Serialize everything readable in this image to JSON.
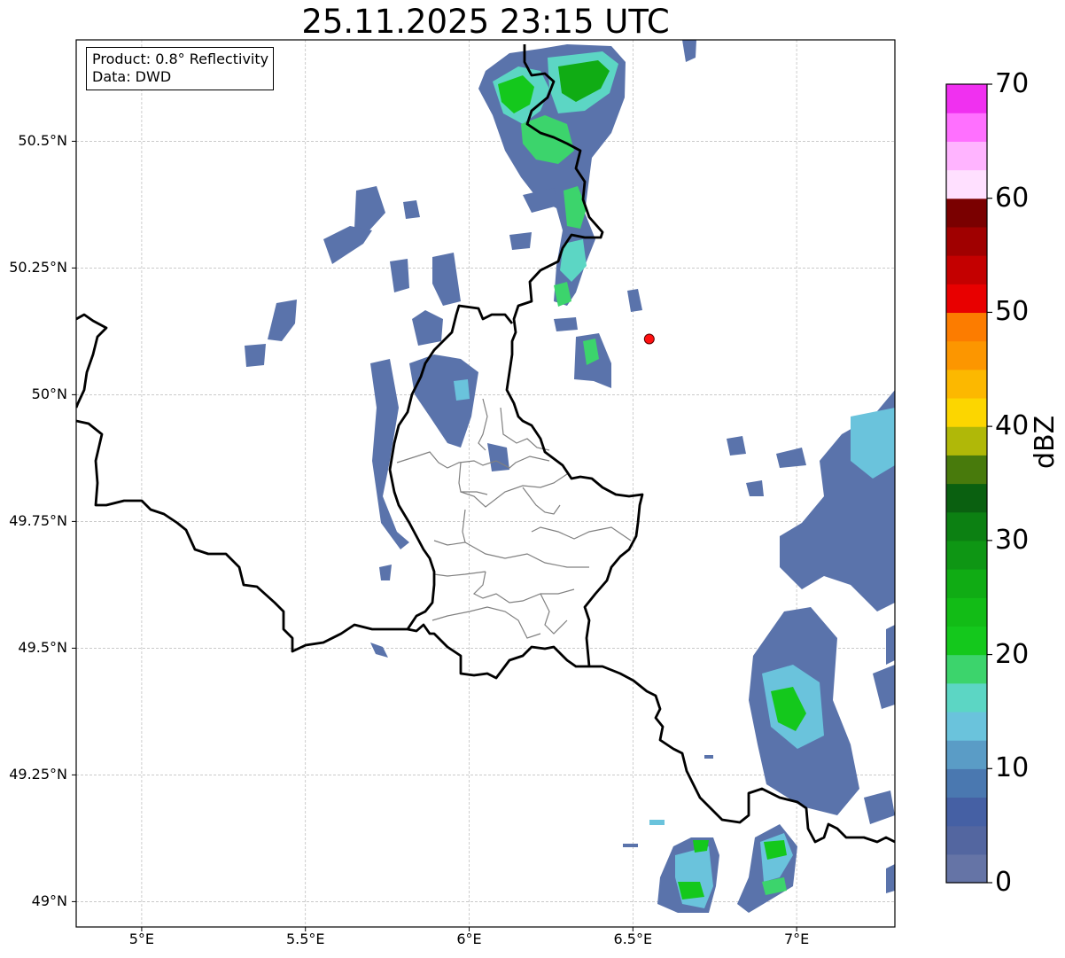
{
  "title": "25.11.2025 23:15 UTC",
  "info": {
    "product": "Product: 0.8° Reflectivity",
    "source": "Data: DWD"
  },
  "map": {
    "extent": {
      "lon_min": 4.8,
      "lon_max": 7.3,
      "lat_min": 48.95,
      "lat_max": 50.7
    },
    "lat_ticks": [
      {
        "value": 50.5,
        "label": "50.5°N"
      },
      {
        "value": 50.25,
        "label": "50.25°N"
      },
      {
        "value": 50.0,
        "label": "50°N"
      },
      {
        "value": 49.75,
        "label": "49.75°N"
      },
      {
        "value": 49.5,
        "label": "49.5°N"
      },
      {
        "value": 49.25,
        "label": "49.25°N"
      },
      {
        "value": 49.0,
        "label": "49°N"
      }
    ],
    "lon_ticks": [
      {
        "value": 5.0,
        "label": "5°E"
      },
      {
        "value": 5.5,
        "label": "5.5°E"
      },
      {
        "value": 6.0,
        "label": "6°E"
      },
      {
        "value": 6.5,
        "label": "6.5°E"
      },
      {
        "value": 7.0,
        "label": "7°E"
      }
    ],
    "gridlines": true,
    "marker": {
      "lon": 6.55,
      "lat": 50.11,
      "color": "#ff1010"
    },
    "border_color": "#000000",
    "district_color": "#808080"
  },
  "colorbar": {
    "label": "dBZ",
    "min": 0,
    "max": 70,
    "tick_values": [
      0,
      10,
      20,
      30,
      40,
      50,
      60,
      70
    ],
    "tick_labels": [
      "0",
      "10",
      "20",
      "30",
      "40",
      "50",
      "60",
      "70"
    ],
    "colors": [
      "#6574a6",
      "#5366a0",
      "#4560a4",
      "#4a78b0",
      "#5a9cc6",
      "#6ac3dc",
      "#5cd6c4",
      "#3cd46c",
      "#14c81c",
      "#12bc16",
      "#10ac14",
      "#0e9614",
      "#0c8012",
      "#0a6010",
      "#487a0c",
      "#b0b808",
      "#fcd600",
      "#fcb800",
      "#fc9600",
      "#fc7c00",
      "#e80000",
      "#c40000",
      "#a00000",
      "#7a0000",
      "#ffe0ff",
      "#ffb4ff",
      "#ff70ff",
      "#f030f0"
    ]
  }
}
